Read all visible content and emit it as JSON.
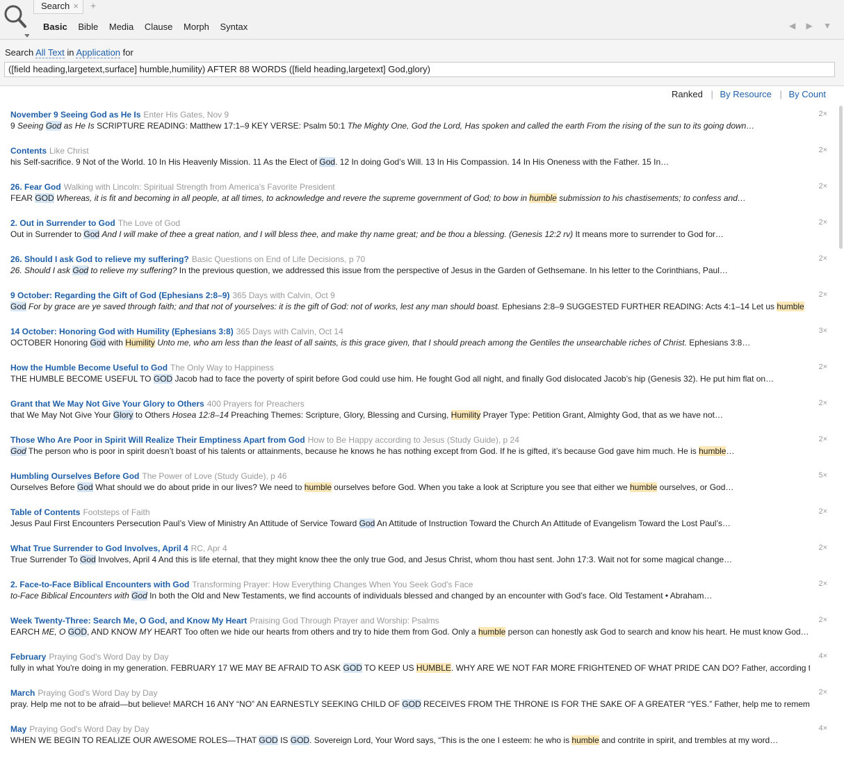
{
  "toolbar": {
    "tab_label": "Search",
    "tab_close": "×",
    "tab_add": "+",
    "subtabs": [
      "Basic",
      "Bible",
      "Media",
      "Clause",
      "Morph",
      "Syntax"
    ],
    "back_arrow": "◀",
    "forward_arrow": "▶",
    "menu_arrow": "▼"
  },
  "query": {
    "prefix": "Search",
    "scope": "All Text",
    "in_word": "in",
    "collection": "Application",
    "suffix": "for",
    "text": "([field heading,largetext,surface] humble,humility) AFTER 88 WORDS ([field heading,largetext] God,glory)"
  },
  "sort": {
    "ranked": "Ranked",
    "by_resource": "By Resource",
    "by_count": "By Count"
  },
  "results": [
    {
      "title": "November 9  Seeing God as He Is",
      "source": "Enter His Gates, Nov 9",
      "count": "2×",
      "snippet": [
        [
          "9    ",
          ""
        ],
        [
          "Seeing ",
          "it"
        ],
        [
          "God",
          "it god"
        ],
        [
          " as He Is",
          "it"
        ],
        [
          " SCRIPTURE READING: Matthew 17:1–9 KEY VERSE: Psalm 50:1 ",
          ""
        ],
        [
          "The Mighty One, God the Lord, Has spoken and called the earth From the rising of the sun to its going down…",
          "it"
        ]
      ]
    },
    {
      "title": "Contents",
      "source": "Like Christ",
      "count": "2×",
      "snippet": [
        [
          "     his Self-sacrifice.     9     Not of the World.     10     In His Heavenly Mission.     11     As the Elect of ",
          ""
        ],
        [
          "God",
          "god"
        ],
        [
          ".     12     In doing God’s Will.     13     In His Compassion.     14     In His Oneness with the Father.     15     In…",
          ""
        ]
      ]
    },
    {
      "title": "26. Fear God",
      "source": "Walking with Lincoln: Spiritual Strength from America's Favorite President",
      "count": "2×",
      "snippet": [
        [
          "FEAR ",
          ""
        ],
        [
          "GOD",
          "god"
        ],
        [
          " ",
          ""
        ],
        [
          "Whereas, it is fit and becoming in all people, at all times, to acknowledge and revere the supreme government of God; to bow in ",
          "it"
        ],
        [
          "humble",
          "it hum"
        ],
        [
          " submission to his chastisements; to confess and…",
          "it"
        ]
      ]
    },
    {
      "title": "2. Out in Surrender to God",
      "source": "The Love of God",
      "count": "2×",
      "snippet": [
        [
          "Out in Surrender to ",
          ""
        ],
        [
          "God",
          "god"
        ],
        [
          " ",
          ""
        ],
        [
          "And I will make of thee a great nation, and I will bless thee, and make thy name great; and be thou a blessing. (Genesis 12:2 rv)",
          "it"
        ],
        [
          " It means more to surrender to God for…",
          ""
        ]
      ]
    },
    {
      "title": " 26. Should I ask God to relieve my suffering?",
      "source": "Basic Questions on End of Life Decisions, p 70",
      "count": "2×",
      "snippet": [
        [
          "26.    Should I ask ",
          "it"
        ],
        [
          "God",
          "it god"
        ],
        [
          " to relieve my suffering?",
          "it"
        ],
        [
          " In the previous question, we addressed this issue from the perspective of Jesus in the Garden of Gethsemane. In his letter to the Corinthians, Paul…",
          ""
        ]
      ]
    },
    {
      "title": "9 October: Regarding the Gift of God (Ephesians 2:8–9)",
      "source": "365 Days with Calvin, Oct 9",
      "count": "2×",
      "snippet": [
        [
          "God",
          "god"
        ],
        [
          " ",
          ""
        ],
        [
          "For by grace are ye saved through faith; and that not of yourselves: it is the gift of God: not of works, lest any man should boast.",
          "it"
        ],
        [
          " Ephesians 2:8–9 SUGGESTED FURTHER READING: Acts 4:1–14 Let us ",
          ""
        ],
        [
          "humble",
          "hum"
        ]
      ]
    },
    {
      "title": "14 October: Honoring God with Humility (Ephesians 3:8)",
      "source": "365 Days with Calvin, Oct 14",
      "count": "3×",
      "snippet": [
        [
          "OCTOBER Honoring ",
          ""
        ],
        [
          "God",
          "god"
        ],
        [
          " with ",
          ""
        ],
        [
          "Humility",
          "hum"
        ],
        [
          " ",
          ""
        ],
        [
          "Unto me, who am less than the least of all saints, is this grace given, that I should preach among the Gentiles the unsearchable riches of Christ.",
          "it"
        ],
        [
          " Ephesians 3:8…",
          ""
        ]
      ]
    },
    {
      "title": "How the Humble Become Useful to God",
      "source": "The Only Way to Happiness",
      "count": "2×",
      "snippet": [
        [
          "THE HUMBLE BECOME USEFUL TO ",
          ""
        ],
        [
          "GOD",
          "god"
        ],
        [
          " Jacob had to face the poverty of spirit before God could use him. He fought God all night, and finally God dislocated Jacob’s hip (Genesis 32). He put him flat on…",
          ""
        ]
      ]
    },
    {
      "title": "Grant that We May Not Give Your Glory to Others",
      "source": "400 Prayers for Preachers",
      "count": "2×",
      "snippet": [
        [
          "that We May Not Give Your ",
          ""
        ],
        [
          "Glory",
          "god"
        ],
        [
          " to Others ",
          ""
        ],
        [
          "Hosea 12:8–14",
          "it"
        ],
        [
          "      Preaching Themes: Scripture, Glory, Blessing and Cursing, ",
          ""
        ],
        [
          "Humility",
          "hum"
        ],
        [
          "      Prayer Type: Petition Grant, Almighty God, that as we have not…",
          ""
        ]
      ]
    },
    {
      "title": "Those Who Are Poor in Spirit Will Realize Their Emptiness Apart from God",
      "source": "How to Be Happy according to Jesus (Study Guide), p 24",
      "count": "2×",
      "snippet": [
        [
          "God",
          "it god"
        ],
        [
          " The person who is poor in spirit doesn’t boast of his talents or attainments, because he knows he has nothing except from God. If he is gifted, it’s because God gave him much. He is ",
          ""
        ],
        [
          "humble",
          "hum"
        ],
        [
          "…",
          ""
        ]
      ]
    },
    {
      "title": "Humbling Ourselves Before God",
      "source": "The Power of Love (Study Guide), p 46",
      "count": "5×",
      "snippet": [
        [
          "Ourselves Before ",
          ""
        ],
        [
          "God",
          "god"
        ],
        [
          " What should we do about pride in our lives? We need to ",
          ""
        ],
        [
          "humble",
          "hum"
        ],
        [
          " ourselves before God. When you take a look at Scripture you see that either we ",
          ""
        ],
        [
          "humble",
          "hum"
        ],
        [
          " ourselves, or God…",
          ""
        ]
      ]
    },
    {
      "title": "Table of Contents",
      "source": "Footsteps of Faith",
      "count": "2×",
      "snippet": [
        [
          "Jesus Paul First Encounters Persecution Paul’s View of Ministry An Attitude of Service Toward ",
          ""
        ],
        [
          "God",
          "god"
        ],
        [
          " An Attitude of Instruction Toward the Church An Attitude of Evangelism Toward the Lost Paul’s…",
          ""
        ]
      ]
    },
    {
      "title": "What True Surrender to God Involves, April 4",
      "source": "RC, Apr 4",
      "count": "2×",
      "snippet": [
        [
          "True Surrender To ",
          ""
        ],
        [
          "God",
          "god"
        ],
        [
          " Involves, April 4 And this is life eternal, that they might know thee the only true God, and Jesus Christ, whom thou hast sent. John 17:3. Wait not for some magical change…",
          ""
        ]
      ]
    },
    {
      "title": "2. Face-to-Face Biblical Encounters with  God",
      "source": "Transforming Prayer: How Everything Changes When You Seek God's Face",
      "count": "2×",
      "snippet": [
        [
          "to-Face Biblical Encounters with ",
          "it"
        ],
        [
          "God",
          "it god"
        ],
        [
          " In both the Old and New Testaments, we find accounts of individuals blessed and changed by an encounter with God’s face. Old Testament • Abraham…",
          ""
        ]
      ]
    },
    {
      "title": "Week Twenty-Three: Search Me, O God, and Know My Heart",
      "source": "Praising God Through Prayer and Worship: Psalms",
      "count": "2×",
      "snippet": [
        [
          "EARCH ",
          ""
        ],
        [
          "ME, O ",
          "it"
        ],
        [
          "GOD",
          "god"
        ],
        [
          ", AND KNOW ",
          ""
        ],
        [
          "MY",
          "it"
        ],
        [
          " HEART  Too often we hide our hearts from others and try to hide them from God. Only a ",
          ""
        ],
        [
          "humble",
          "hum"
        ],
        [
          " person can honestly ask God to search and know his heart. He must know God…",
          ""
        ]
      ]
    },
    {
      "title": "February",
      "source": "Praying God's Word Day by Day",
      "count": "4×",
      "snippet": [
        [
          "fully in what You're doing in my generation. FEBRUARY 17 WE MAY BE AFRAID TO ASK ",
          ""
        ],
        [
          "GOD",
          "god"
        ],
        [
          " TO KEEP US ",
          ""
        ],
        [
          "HUMBLE",
          "hum"
        ],
        [
          ". WHY ARE WE NOT FAR MORE FRIGHTENED OF WHAT PRIDE CAN DO?  Father, according to…",
          ""
        ]
      ]
    },
    {
      "title": "March",
      "source": "Praying God's Word Day by Day",
      "count": "2×",
      "snippet": [
        [
          "pray. Help me not to be afraid—but believe! MARCH 16 ANY “NO” AN EARNESTLY SEEKING CHILD OF ",
          ""
        ],
        [
          "GOD",
          "god"
        ],
        [
          " RECEIVES FROM THE THRONE IS FOR THE SAKE OF A GREATER “YES.”  Father, help me to remember…",
          ""
        ]
      ]
    },
    {
      "title": "May",
      "source": "Praying God's Word Day by Day",
      "count": "4×",
      "snippet": [
        [
          "WHEN WE BEGIN TO REALIZE OUR AWESOME ROLES—THAT ",
          ""
        ],
        [
          "GOD",
          "god"
        ],
        [
          " IS ",
          ""
        ],
        [
          "GOD",
          "god"
        ],
        [
          ".  Sovereign Lord, Your Word says, “This is the one I esteem: he who is ",
          ""
        ],
        [
          "humble",
          "hum"
        ],
        [
          " and contrite in spirit, and trembles at my word…",
          ""
        ]
      ]
    }
  ]
}
